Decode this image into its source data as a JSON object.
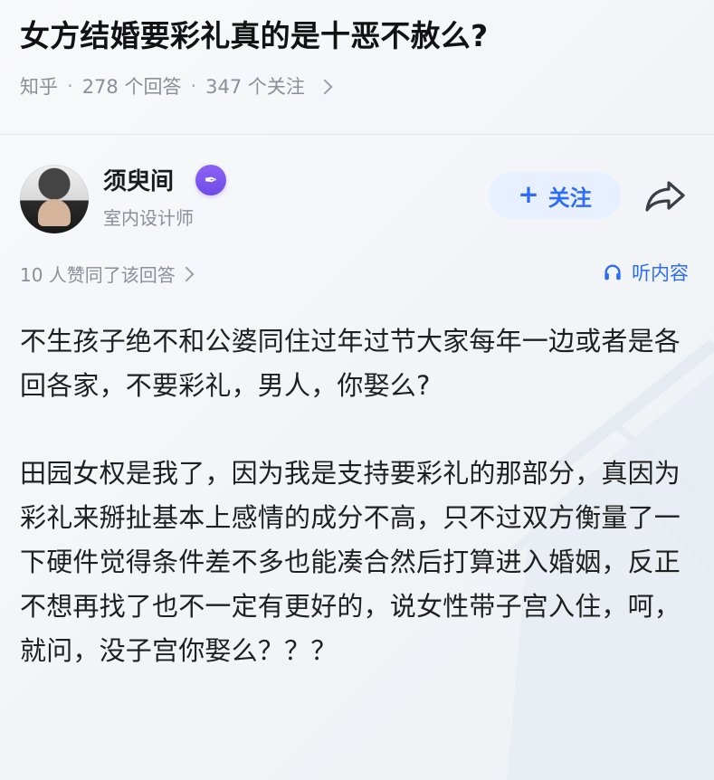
{
  "question": {
    "title": "女方结婚要彩礼真的是十恶不赦么?",
    "source": "知乎",
    "answers": "278 个回答",
    "follows": "347 个关注"
  },
  "author": {
    "name": "须臾间",
    "title": "室内设计师",
    "badge_icon": "pen-badge-icon",
    "follow_label": "关注",
    "share_icon": "share-icon"
  },
  "answer_meta": {
    "agree_text": "10 人赞同了该回答",
    "listen_label": "听内容"
  },
  "content": {
    "paragraphs": [
      "不生孩子绝不和公婆同住过年过节大家每年一边或者是各回各家，不要彩礼，男人，你娶么?",
      "田园女权是我了，因为我是支持要彩礼的那部分，真因为彩礼来掰扯基本上感情的成分不高，只不过双方衡量了一下硬件觉得条件差不多也能凑合然后打算进入婚姻，反正不想再找了也不一定有更好的，说女性带子宫入住，呵，就问，没子宫你娶么？？？"
    ]
  },
  "colors": {
    "accent": "#2d6df5",
    "muted_text": "#8a8f99",
    "follow_bg": "#e8f0ff",
    "badge": "#7a55ef"
  }
}
